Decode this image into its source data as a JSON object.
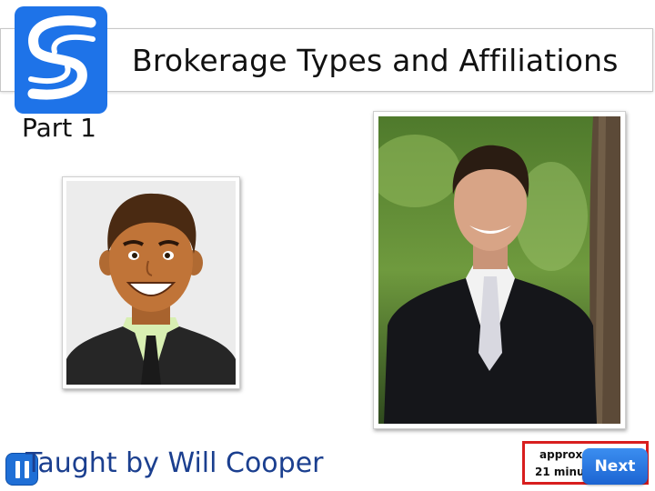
{
  "header": {
    "title": "Brokerage Types and Affiliations",
    "part_label": "Part 1"
  },
  "instructor": {
    "taught_by": "Taught by Will Cooper"
  },
  "footer": {
    "duration_line1": "approx",
    "duration_line2": "21 minu",
    "next_label": "Next"
  },
  "colors": {
    "logo_blue": "#1e73e8",
    "title_text": "#111111",
    "instructor_text": "#1b3f8f",
    "next_button": "#1f6fd6",
    "highlight_border": "#d81e1e"
  },
  "icons": {
    "logo": "s-logo-icon",
    "pause": "pause-icon"
  }
}
